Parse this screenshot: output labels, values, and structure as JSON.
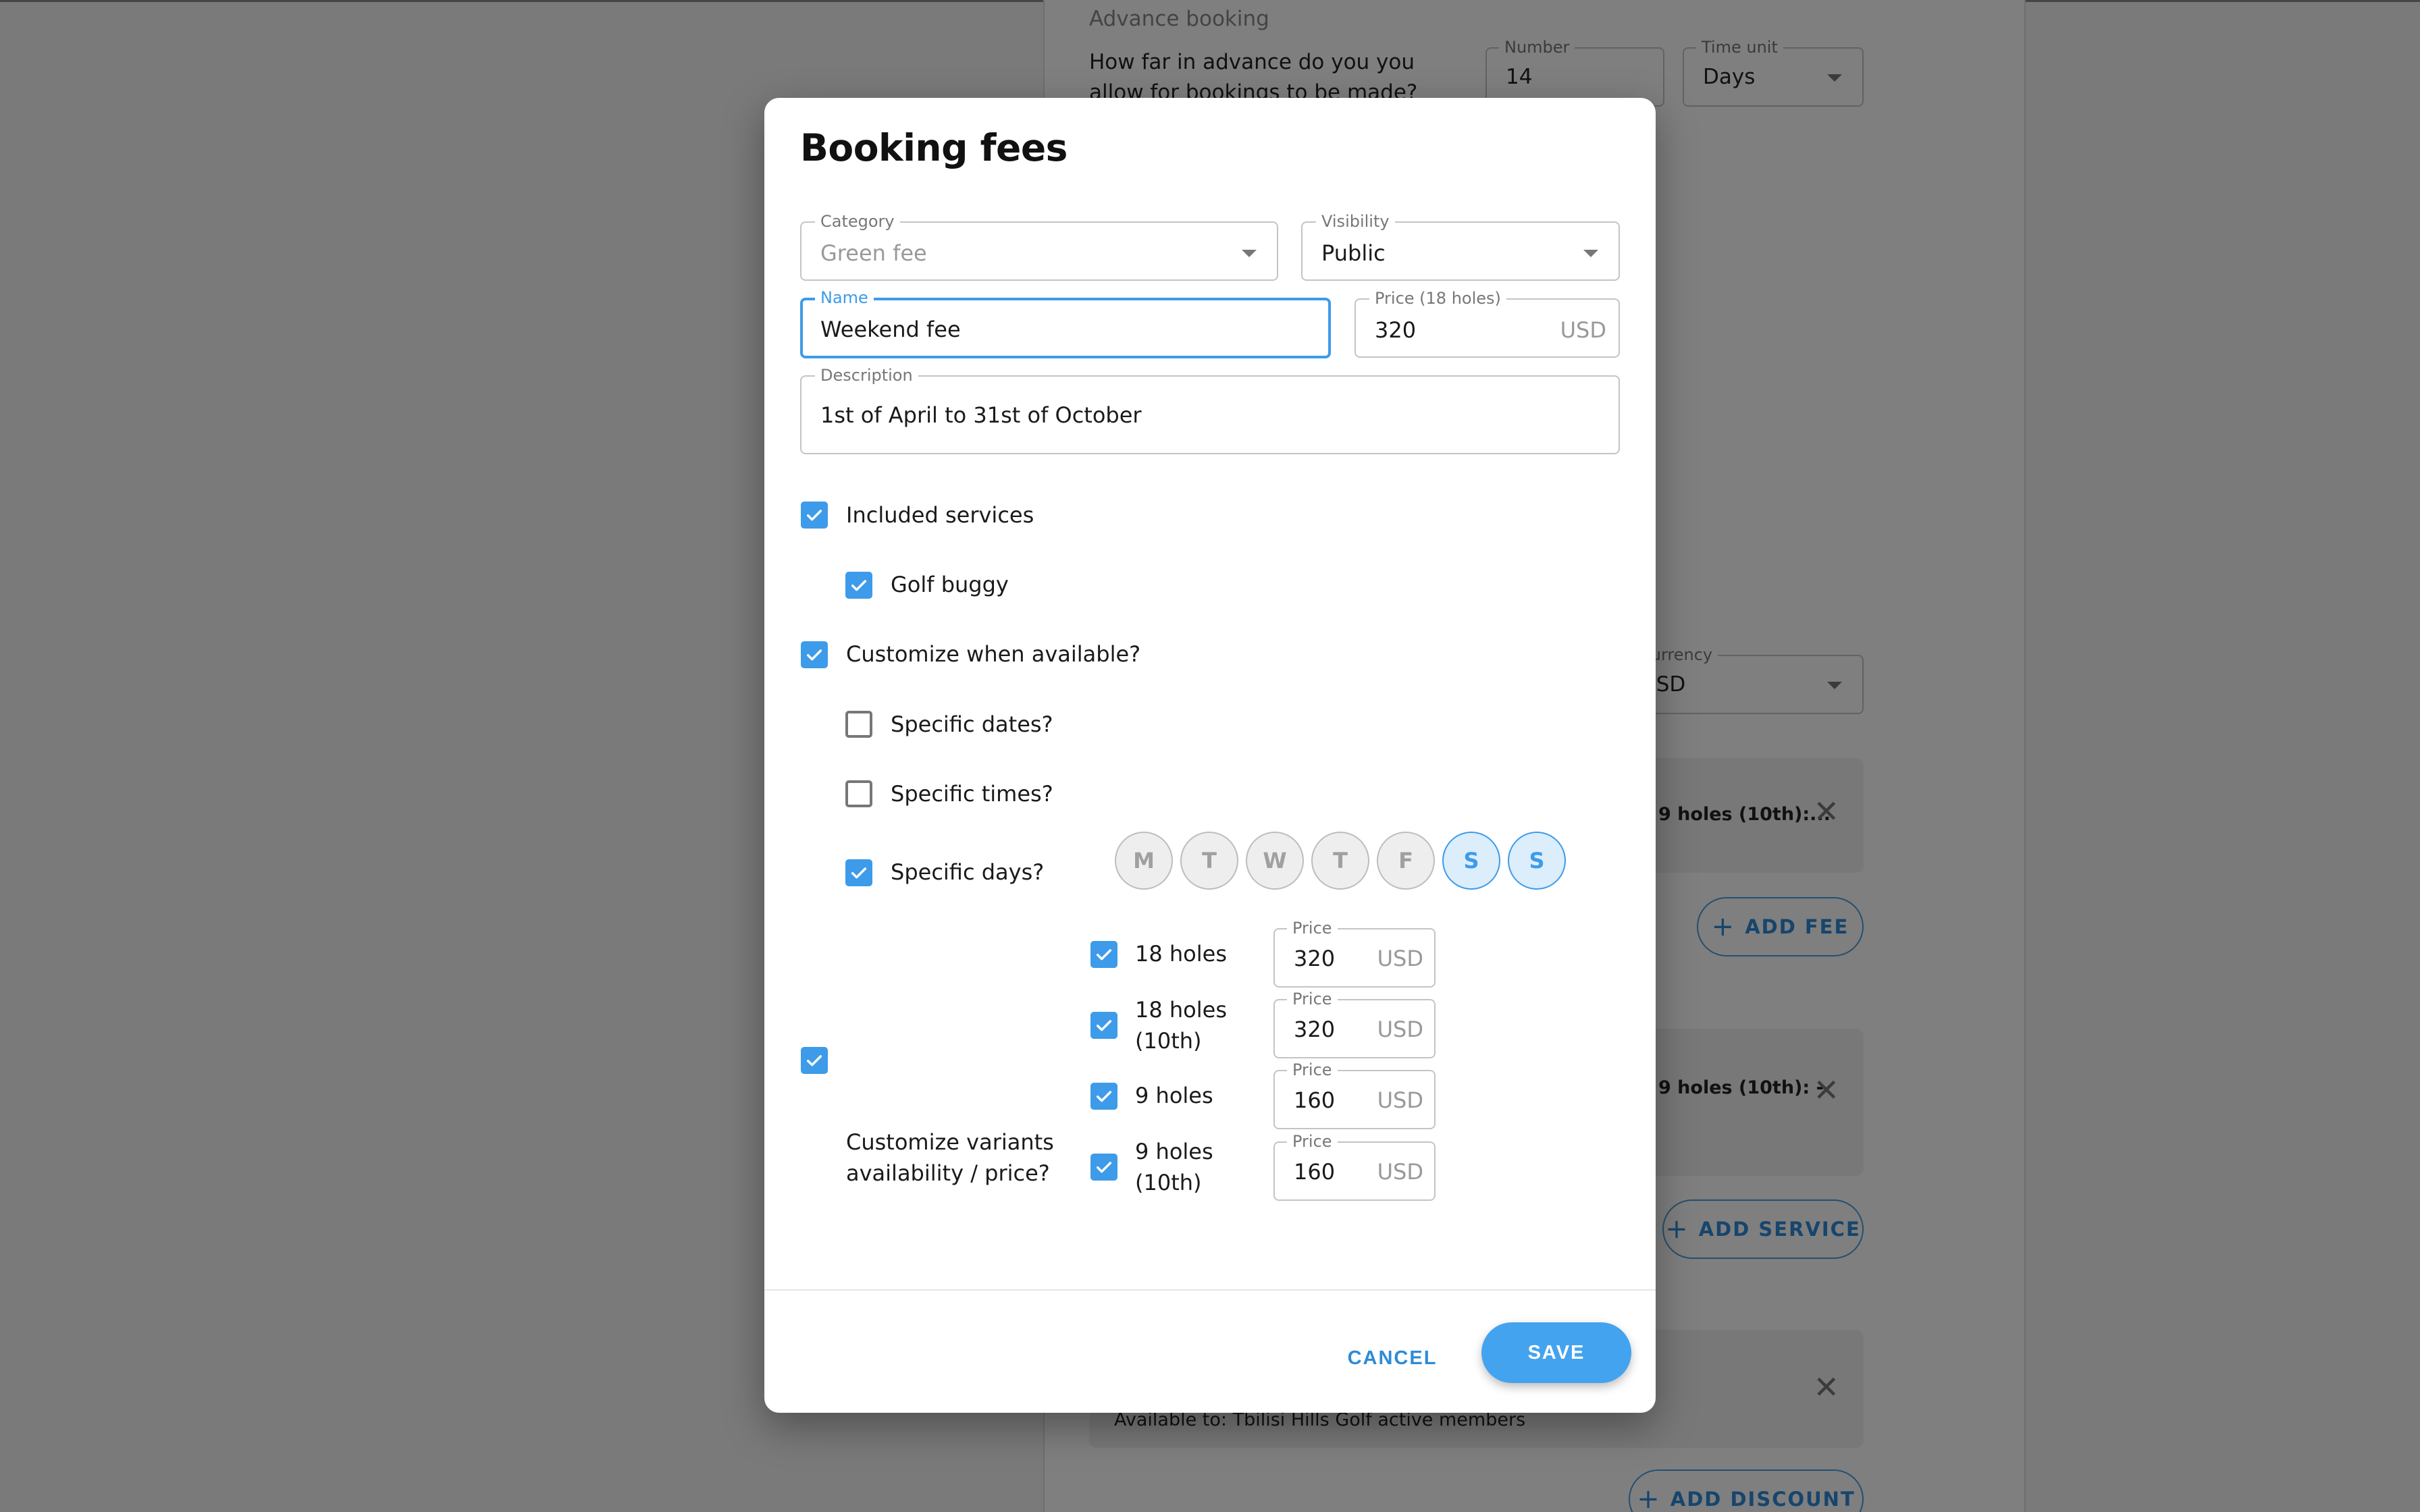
{
  "background": {
    "advance_booking": {
      "title": "Advance booking",
      "question": "How far in advance do you you allow for bookings to be made?",
      "number_label": "Number",
      "number_value": "14",
      "time_unit_label": "Time unit",
      "time_unit_value": "Days"
    },
    "currency": {
      "label": "Currency",
      "value": "USD"
    },
    "fee_card_text": "9 holes (10th):...",
    "add_fee_label": "ADD FEE",
    "service_card_text": "9 holes (10th): -",
    "add_service_label": "ADD SERVICE",
    "discount_available_text": "Available to: Tbilisi Hills Golf active members",
    "add_discount_label": "ADD DISCOUNT"
  },
  "modal": {
    "title": "Booking fees",
    "category": {
      "label": "Category",
      "value": "Green fee"
    },
    "visibility": {
      "label": "Visibility",
      "value": "Public"
    },
    "name": {
      "label": "Name",
      "value": "Weekend fee"
    },
    "price": {
      "label": "Price (18 holes)",
      "value": "320",
      "unit": "USD"
    },
    "description": {
      "label": "Description",
      "value": "1st of April to 31st of October"
    },
    "included_services": {
      "label": "Included services",
      "checked": true
    },
    "golf_buggy": {
      "label": "Golf buggy",
      "checked": true
    },
    "customize_when": {
      "label": "Customize when available?",
      "checked": true
    },
    "specific_dates": {
      "label": "Specific dates?",
      "checked": false
    },
    "specific_times": {
      "label": "Specific times?",
      "checked": false
    },
    "specific_days": {
      "label": "Specific days?",
      "checked": true
    },
    "days": [
      {
        "label": "M",
        "selected": false
      },
      {
        "label": "T",
        "selected": false
      },
      {
        "label": "W",
        "selected": false
      },
      {
        "label": "T",
        "selected": false
      },
      {
        "label": "F",
        "selected": false
      },
      {
        "label": "S",
        "selected": true
      },
      {
        "label": "S",
        "selected": true
      }
    ],
    "customize_variants": {
      "label_line1": "Customize variants",
      "label_line2": "availability / price?",
      "checked": true
    },
    "variants": [
      {
        "line1": "18 holes",
        "line2": "",
        "checked": true,
        "price_label": "Price",
        "price": "320",
        "unit": "USD"
      },
      {
        "line1": "18 holes",
        "line2": "(10th)",
        "checked": true,
        "price_label": "Price",
        "price": "320",
        "unit": "USD"
      },
      {
        "line1": "9 holes",
        "line2": "",
        "checked": true,
        "price_label": "Price",
        "price": "160",
        "unit": "USD"
      },
      {
        "line1": "9 holes",
        "line2": "(10th)",
        "checked": true,
        "price_label": "Price",
        "price": "160",
        "unit": "USD"
      }
    ],
    "cancel_label": "CANCEL",
    "save_label": "SAVE"
  },
  "colors": {
    "accent": "#3d9be9",
    "save_button": "#44a3ef",
    "overlay": "rgba(0,0,0,0.5)"
  }
}
